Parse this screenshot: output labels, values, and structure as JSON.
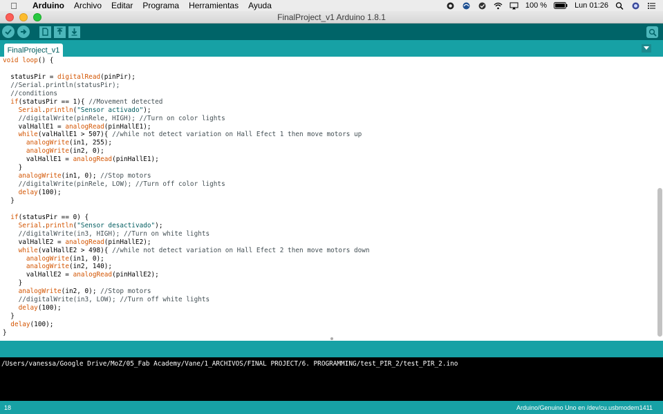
{
  "menubar": {
    "app": "Arduino",
    "items": [
      "Archivo",
      "Editar",
      "Programa",
      "Herramientas",
      "Ayuda"
    ],
    "battery": "100 %",
    "clock": "Lun 01:26"
  },
  "window": {
    "title": "FinalProject_v1 Arduino 1.8.1"
  },
  "tabs": [
    {
      "label": "FinalProject_v1"
    }
  ],
  "code": [
    [
      [
        "kw",
        "void"
      ],
      [
        "n",
        " "
      ],
      [
        "kw",
        "loop"
      ],
      [
        "n",
        "() {"
      ]
    ],
    [
      [
        "n",
        ""
      ]
    ],
    [
      [
        "n",
        "  statusPir = "
      ],
      [
        "kw",
        "digitalRead"
      ],
      [
        "n",
        "(pinPir);"
      ]
    ],
    [
      [
        "cm",
        "  //Serial.println(statusPir);"
      ]
    ],
    [
      [
        "cm",
        "  //conditions"
      ]
    ],
    [
      [
        "n",
        "  "
      ],
      [
        "kw",
        "if"
      ],
      [
        "n",
        "(statusPir == 1){ "
      ],
      [
        "cm",
        "//Movement detected"
      ]
    ],
    [
      [
        "n",
        "    "
      ],
      [
        "kw",
        "Serial"
      ],
      [
        "n",
        "."
      ],
      [
        "kw",
        "println"
      ],
      [
        "n",
        "("
      ],
      [
        "st",
        "\"Sensor activado\""
      ],
      [
        "n",
        ");"
      ]
    ],
    [
      [
        "cm",
        "    //digitalWrite(pinRele, HIGH); //Turn on color lights"
      ]
    ],
    [
      [
        "n",
        "    valHallE1 = "
      ],
      [
        "kw",
        "analogRead"
      ],
      [
        "n",
        "(pinHallE1);"
      ]
    ],
    [
      [
        "n",
        "    "
      ],
      [
        "kw",
        "while"
      ],
      [
        "n",
        "(valHallE1 > 507){ "
      ],
      [
        "cm",
        "//while not detect variation on Hall Efect 1 then move motors up"
      ]
    ],
    [
      [
        "n",
        "      "
      ],
      [
        "kw",
        "analogWrite"
      ],
      [
        "n",
        "(in1, 255);"
      ]
    ],
    [
      [
        "n",
        "      "
      ],
      [
        "kw",
        "analogWrite"
      ],
      [
        "n",
        "(in2, 0);"
      ]
    ],
    [
      [
        "n",
        "      valHallE1 = "
      ],
      [
        "kw",
        "analogRead"
      ],
      [
        "n",
        "(pinHallE1);"
      ]
    ],
    [
      [
        "n",
        "    }"
      ]
    ],
    [
      [
        "n",
        "    "
      ],
      [
        "kw",
        "analogWrite"
      ],
      [
        "n",
        "(in1, 0); "
      ],
      [
        "cm",
        "//Stop motors"
      ]
    ],
    [
      [
        "cm",
        "    //digitalWrite(pinRele, LOW); //Turn off color lights"
      ]
    ],
    [
      [
        "n",
        "    "
      ],
      [
        "kw",
        "delay"
      ],
      [
        "n",
        "(100);"
      ]
    ],
    [
      [
        "n",
        "  }"
      ]
    ],
    [
      [
        "n",
        ""
      ]
    ],
    [
      [
        "n",
        "  "
      ],
      [
        "kw",
        "if"
      ],
      [
        "n",
        "(statusPir == 0) {"
      ]
    ],
    [
      [
        "n",
        "    "
      ],
      [
        "kw",
        "Serial"
      ],
      [
        "n",
        "."
      ],
      [
        "kw",
        "println"
      ],
      [
        "n",
        "("
      ],
      [
        "st",
        "\"Sensor desactivado\""
      ],
      [
        "n",
        ");"
      ]
    ],
    [
      [
        "cm",
        "    //digitalWrite(in3, HIGH); //Turn on white lights"
      ]
    ],
    [
      [
        "n",
        "    valHallE2 = "
      ],
      [
        "kw",
        "analogRead"
      ],
      [
        "n",
        "(pinHallE2);"
      ]
    ],
    [
      [
        "n",
        "    "
      ],
      [
        "kw",
        "while"
      ],
      [
        "n",
        "(valHallE2 > 498){ "
      ],
      [
        "cm",
        "//while not detect variation on Hall Efect 2 then move motors down"
      ]
    ],
    [
      [
        "n",
        "      "
      ],
      [
        "kw",
        "analogWrite"
      ],
      [
        "n",
        "(in1, 0);"
      ]
    ],
    [
      [
        "n",
        "      "
      ],
      [
        "kw",
        "analogWrite"
      ],
      [
        "n",
        "(in2, 140);"
      ]
    ],
    [
      [
        "n",
        "      valHallE2 = "
      ],
      [
        "kw",
        "analogRead"
      ],
      [
        "n",
        "(pinHallE2);"
      ]
    ],
    [
      [
        "n",
        "    }"
      ]
    ],
    [
      [
        "n",
        "    "
      ],
      [
        "kw",
        "analogWrite"
      ],
      [
        "n",
        "(in2, 0); "
      ],
      [
        "cm",
        "//Stop motors"
      ]
    ],
    [
      [
        "cm",
        "    //digitalWrite(in3, LOW); //Turn off white lights"
      ]
    ],
    [
      [
        "n",
        "    "
      ],
      [
        "kw",
        "delay"
      ],
      [
        "n",
        "(100);"
      ]
    ],
    [
      [
        "n",
        "  }"
      ]
    ],
    [
      [
        "n",
        "  "
      ],
      [
        "kw",
        "delay"
      ],
      [
        "n",
        "(100);"
      ]
    ],
    [
      [
        "n",
        "}"
      ]
    ]
  ],
  "console": {
    "text": "/Users/vanessa/Google Drive/MoZ/05_Fab Academy/Vane/1_ARCHIVOS/FINAL PROJECT/6. PROGRAMMING/test_PIR_2/test_PIR_2.ino"
  },
  "status": {
    "line": "18",
    "board": "Arduino/Genuino Uno en /dev/cu.usbmodem1411"
  },
  "colors": {
    "toolbar": "#006468",
    "tabbar": "#17a1a5",
    "keyword": "#d35400",
    "comment": "#434f54"
  }
}
